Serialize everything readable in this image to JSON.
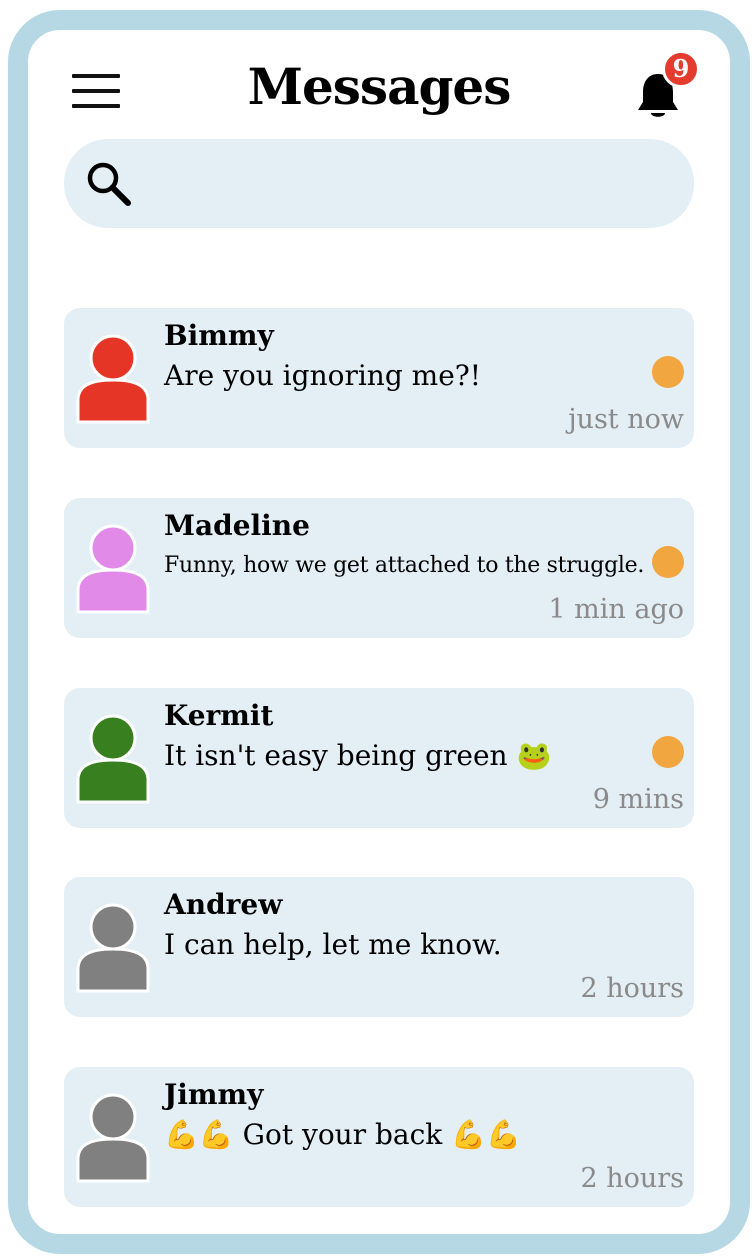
{
  "header": {
    "title": "Messages",
    "menu_icon": "hamburger-menu-icon",
    "bell_icon": "bell-icon",
    "notification_count": "9",
    "badge_color": "#e43b2f"
  },
  "search": {
    "icon": "search-icon",
    "placeholder": "",
    "value": ""
  },
  "colors": {
    "frame_border": "#b6d8e4",
    "card_background": "#e3eef5",
    "unread_dot": "#f2a640",
    "timestamp": "#8a8a8a"
  },
  "conversations": [
    {
      "name": "Bimmy",
      "message": "Are you ignoring me?!",
      "time": "just now",
      "unread": true,
      "avatar_color": "#e53527"
    },
    {
      "name": "Madeline",
      "message": "Funny, how we get attached to the struggle.",
      "time": "1 min ago",
      "unread": true,
      "avatar_color": "#e18ae8"
    },
    {
      "name": "Kermit",
      "message": "It isn't easy being green 🐸",
      "time": "9 mins",
      "unread": true,
      "avatar_color": "#38801f"
    },
    {
      "name": "Andrew",
      "message": "I can help, let me know.",
      "time": "2 hours",
      "unread": false,
      "avatar_color": "#808080"
    },
    {
      "name": "Jimmy",
      "message": "💪💪 Got your back 💪💪",
      "time": "2 hours",
      "unread": false,
      "avatar_color": "#808080"
    }
  ]
}
